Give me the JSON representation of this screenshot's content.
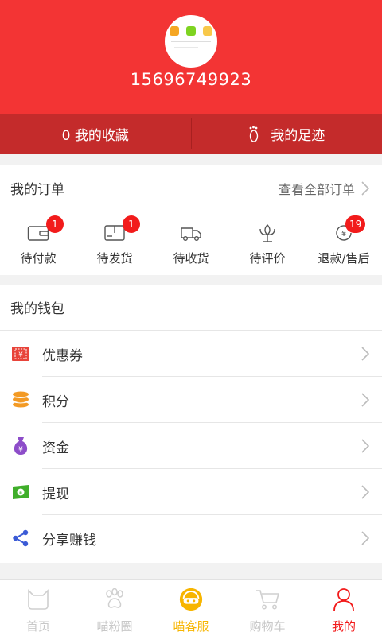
{
  "profile": {
    "phone": "15696749923"
  },
  "favorites": {
    "collect_label": "0 我的收藏",
    "footprint_label": "我的足迹"
  },
  "orders": {
    "title": "我的订单",
    "view_all": "查看全部订单",
    "items": [
      {
        "label": "待付款",
        "icon": "wallet-icon",
        "badge": "1"
      },
      {
        "label": "待发货",
        "icon": "package-icon",
        "badge": "1"
      },
      {
        "label": "待收货",
        "icon": "truck-icon",
        "badge": ""
      },
      {
        "label": "待评价",
        "icon": "flower-icon",
        "badge": ""
      },
      {
        "label": "退款/售后",
        "icon": "refund-icon",
        "badge": "19"
      }
    ]
  },
  "wallet": {
    "title": "我的钱包",
    "items": [
      {
        "label": "优惠券",
        "icon": "coupon-icon",
        "color": "#e8443a"
      },
      {
        "label": "积分",
        "icon": "points-coins-icon",
        "color": "#f39a24"
      },
      {
        "label": "资金",
        "icon": "money-bag-icon",
        "color": "#8d4dc9"
      },
      {
        "label": "提现",
        "icon": "withdraw-cash-icon",
        "color": "#3fae2a"
      },
      {
        "label": "分享赚钱",
        "icon": "share-icon",
        "color": "#3b5bd6"
      }
    ]
  },
  "tabbar": {
    "items": [
      {
        "label": "首页",
        "icon": "cat-home-icon"
      },
      {
        "label": "喵粉圈",
        "icon": "paw-icon"
      },
      {
        "label": "喵客服",
        "icon": "service-icon"
      },
      {
        "label": "购物车",
        "icon": "cart-icon"
      },
      {
        "label": "我的",
        "icon": "user-icon"
      }
    ]
  },
  "colors": {
    "brand_red": "#f33434",
    "fav_bar": "#c42b2b",
    "badge": "#f21b1b",
    "service_yellow": "#f7b500"
  }
}
